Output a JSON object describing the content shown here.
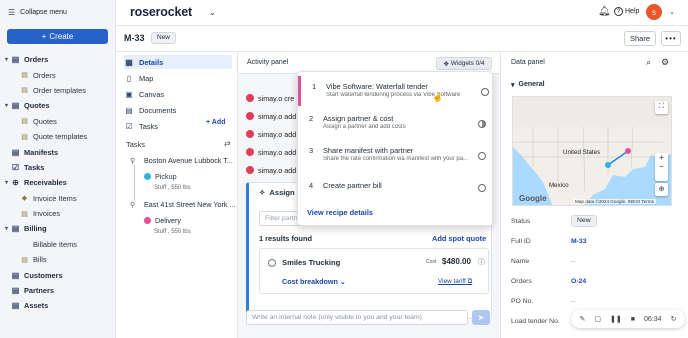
{
  "sidebar": {
    "collapse_label": "Collapse menu",
    "create_label": "Create",
    "items": [
      {
        "label": "Orders",
        "level": "top",
        "caret": "▾",
        "icon": "▤"
      },
      {
        "label": "Orders",
        "level": "sub",
        "icon": "▤"
      },
      {
        "label": "Order templates",
        "level": "sub",
        "icon": "▤"
      },
      {
        "label": "Quotes",
        "level": "top",
        "caret": "▾",
        "icon": "▤"
      },
      {
        "label": "Quotes",
        "level": "sub",
        "icon": "▤"
      },
      {
        "label": "Quote templates",
        "level": "sub",
        "icon": "▤"
      },
      {
        "label": "Manifests",
        "level": "top",
        "caret": "",
        "icon": "▤"
      },
      {
        "label": "Tasks",
        "level": "top",
        "caret": "",
        "icon": "☑"
      },
      {
        "label": "Receivables",
        "level": "top",
        "caret": "▾",
        "icon": "⊕"
      },
      {
        "label": "Invoice Items",
        "level": "sub",
        "icon": "◆"
      },
      {
        "label": "Invoices",
        "level": "sub",
        "icon": "▤"
      },
      {
        "label": "Billing",
        "level": "top",
        "caret": "▾",
        "icon": "▤"
      },
      {
        "label": "Billable Items",
        "level": "sub",
        "icon": ""
      },
      {
        "label": "Bills",
        "level": "sub",
        "icon": "▤"
      },
      {
        "label": "Customers",
        "level": "top",
        "caret": "",
        "icon": "▤"
      },
      {
        "label": "Partners",
        "level": "top",
        "caret": "",
        "icon": "▤"
      },
      {
        "label": "Assets",
        "level": "top",
        "caret": "",
        "icon": "▤"
      }
    ]
  },
  "topbar": {
    "logo": "roserocket",
    "help_label": "Help",
    "avatar_initial": "s"
  },
  "titlebar": {
    "order_id": "M-33",
    "status": "New",
    "share_label": "Share",
    "more_label": "•••"
  },
  "leftpane": {
    "items": [
      "Details",
      "Map",
      "Canvas",
      "Documents",
      "Tasks"
    ],
    "add_label": "+ Add",
    "tasks_header": "Tasks",
    "stops": [
      {
        "address": "Boston Avenue Lubbock T...",
        "action": "Pickup",
        "meta": "Stuff , 550 lbs",
        "color": "#2fb4d8"
      },
      {
        "address": "East 41st Street New York ...",
        "action": "Delivery",
        "meta": "Stuff , 550 lbs",
        "color": "#e0519c"
      }
    ]
  },
  "activity": {
    "title": "Activity panel",
    "widgets_label": "Widgets 0/4",
    "feed": [
      "simay.o cre",
      "simay.o add",
      "simay.o add",
      "simay.o add",
      "simay.o add"
    ],
    "assign_title": "Assign pa",
    "filter_placeholder": "Filter partn",
    "results": "1 results found",
    "add_quote": "Add spot quote",
    "carrier": {
      "name": "Smiles Trucking",
      "cost_label": "Cost",
      "cost": "$480.00",
      "breakdown": "Cost breakdown",
      "tariff": "View tariff"
    },
    "note_placeholder": "Write an internal note (only visible to you and your team)"
  },
  "dropdown": {
    "items": [
      {
        "num": "1",
        "title": "Vibe Software: Waterfall tender",
        "sub": "Start waterfall tendering process via Vibe Software",
        "state": "empty"
      },
      {
        "num": "2",
        "title": "Assign partner & cost",
        "sub": "Assign a partner and add costs",
        "state": "half"
      },
      {
        "num": "3",
        "title": "Share manifest with partner",
        "sub": "Share the rate confirmation via manifest with your pa...",
        "state": "empty"
      },
      {
        "num": "4",
        "title": "Create partner bill",
        "sub": "",
        "state": "empty"
      }
    ],
    "link": "View recipe details"
  },
  "datapanel": {
    "title": "Data panel",
    "general": "General",
    "map": {
      "labels": [
        "United States",
        "Mexico"
      ],
      "attribution": "Map data ©2024 Google, INEGI",
      "terms": "Terms",
      "google": "Google"
    },
    "fields": [
      {
        "label": "Status",
        "value": "New",
        "kind": "new"
      },
      {
        "label": "Full ID",
        "value": "M-33",
        "kind": "link"
      },
      {
        "label": "Name",
        "value": "--",
        "kind": "dim"
      },
      {
        "label": "Orders",
        "value": "O-24",
        "kind": "link"
      },
      {
        "label": "PO No.",
        "value": "--",
        "kind": "dim"
      },
      {
        "label": "Load tender No.",
        "value": "",
        "kind": "dim"
      }
    ]
  },
  "toolbar": {
    "time": "06:34"
  }
}
